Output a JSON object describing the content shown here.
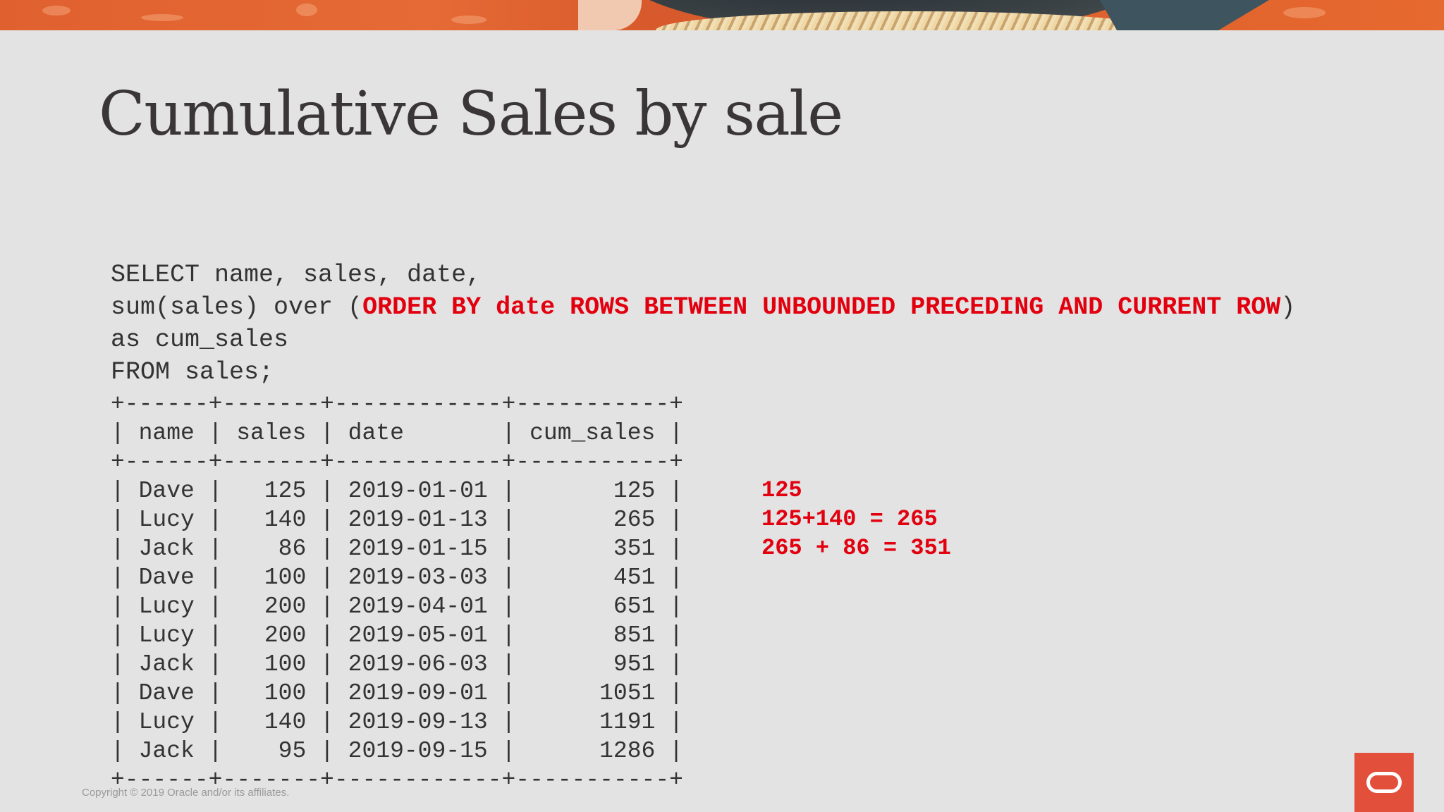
{
  "slide": {
    "title": "Cumulative Sales by sale",
    "copyright": "Copyright © 2019 Oracle and/or its affiliates."
  },
  "sql": {
    "line1": "SELECT name, sales, date,",
    "line2_prefix": "sum(sales) over (",
    "line2_highlight": "ORDER BY date ROWS BETWEEN UNBOUNDED PRECEDING AND CURRENT ROW",
    "line2_suffix": ")",
    "line3": "as cum_sales",
    "line4": "FROM sales;"
  },
  "result_table": {
    "border": "+------+-------+------------+-----------+",
    "header": "| name | sales | date       | cum_sales |",
    "rows": [
      "| Dave |   125 | 2019-01-01 |       125 |",
      "| Lucy |   140 | 2019-01-13 |       265 |",
      "| Jack |    86 | 2019-01-15 |       351 |",
      "| Dave |   100 | 2019-03-03 |       451 |",
      "| Lucy |   200 | 2019-04-01 |       651 |",
      "| Lucy |   200 | 2019-05-01 |       851 |",
      "| Jack |   100 | 2019-06-03 |       951 |",
      "| Dave |   100 | 2019-09-01 |      1051 |",
      "| Lucy |   140 | 2019-09-13 |      1191 |",
      "| Jack |    95 | 2019-09-15 |      1286 |"
    ]
  },
  "annotations": [
    "125",
    "125+140 = 265",
    "265 + 86 = 351"
  ],
  "colors": {
    "highlight": "#e2000f",
    "logo": "#e24f3b",
    "banner": "#e0612f"
  },
  "icons": {
    "logo": "oracle-logo-icon"
  }
}
